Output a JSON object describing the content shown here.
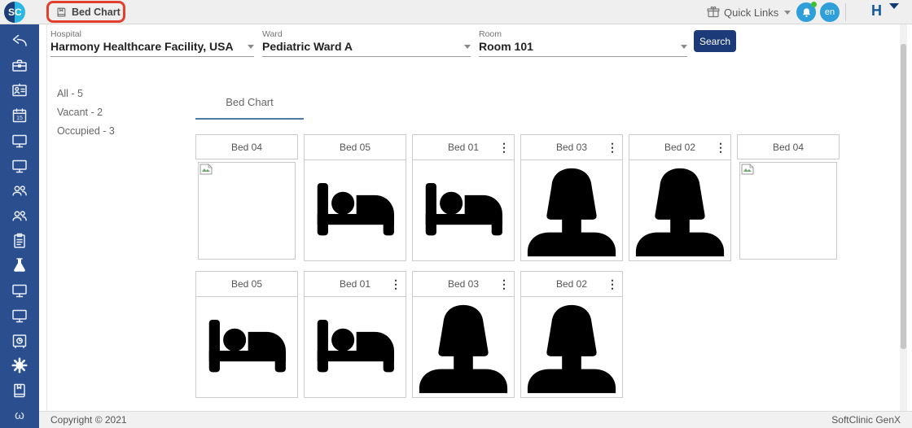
{
  "app": {
    "logo_left": "S",
    "logo_right": "C"
  },
  "topbar": {
    "page_title": "Bed Chart",
    "quick_links_label": "Quick Links",
    "language_badge": "en",
    "profile_initial": "H"
  },
  "filters": {
    "hospital_label": "Hospital",
    "hospital_value": "Harmony Healthcare Facility, USA",
    "ward_label": "Ward",
    "ward_value": "Pediatric Ward A",
    "room_label": "Room",
    "room_value": "Room 101",
    "search_button": "Search"
  },
  "summary": {
    "all": "All - 5",
    "vacant": "Vacant - 2",
    "occupied": "Occupied - 3"
  },
  "tabs": {
    "active_tab": "Bed Chart"
  },
  "bed_grid": {
    "menu_glyph": "⋮",
    "row1": [
      {
        "label": "Bed 04",
        "state": "image-missing",
        "has_menu": false
      },
      {
        "label": "Bed 05",
        "state": "vacant",
        "has_menu": false
      },
      {
        "label": "Bed 01",
        "state": "vacant",
        "has_menu": true
      },
      {
        "label": "Bed 03",
        "state": "occupied",
        "has_menu": true
      },
      {
        "label": "Bed 02",
        "state": "occupied",
        "has_menu": true
      },
      {
        "label": "Bed 04",
        "state": "image-missing",
        "has_menu": false
      }
    ],
    "row2": [
      {
        "label": "Bed 05",
        "state": "vacant",
        "has_menu": false
      },
      {
        "label": "Bed 01",
        "state": "vacant",
        "has_menu": true
      },
      {
        "label": "Bed 03",
        "state": "occupied",
        "has_menu": true
      },
      {
        "label": "Bed 02",
        "state": "occupied",
        "has_menu": true
      }
    ]
  },
  "sidebar_icons": [
    "reply-arrow-icon",
    "briefcase-icon",
    "id-card-icon",
    "calendar-15-icon",
    "monitor-icon",
    "monitor-icon",
    "users-icon",
    "users-icon",
    "clipboard-icon",
    "flask-icon",
    "monitor-icon",
    "monitor-icon",
    "safe-icon",
    "gear-icon",
    "book-icon",
    "omega-icon"
  ],
  "footer": {
    "copyright": "Copyright © 2021",
    "brand": "SoftClinic GenX"
  },
  "colors": {
    "sidebar": "#2b4f8e",
    "annotation_red": "#e2402d",
    "search_button": "#1c3a78",
    "badge_blue": "#2f9fd9",
    "tab_underline": "#4d7da6",
    "notification_dot": "#3fbf34",
    "profile_blue": "#1456a0"
  }
}
